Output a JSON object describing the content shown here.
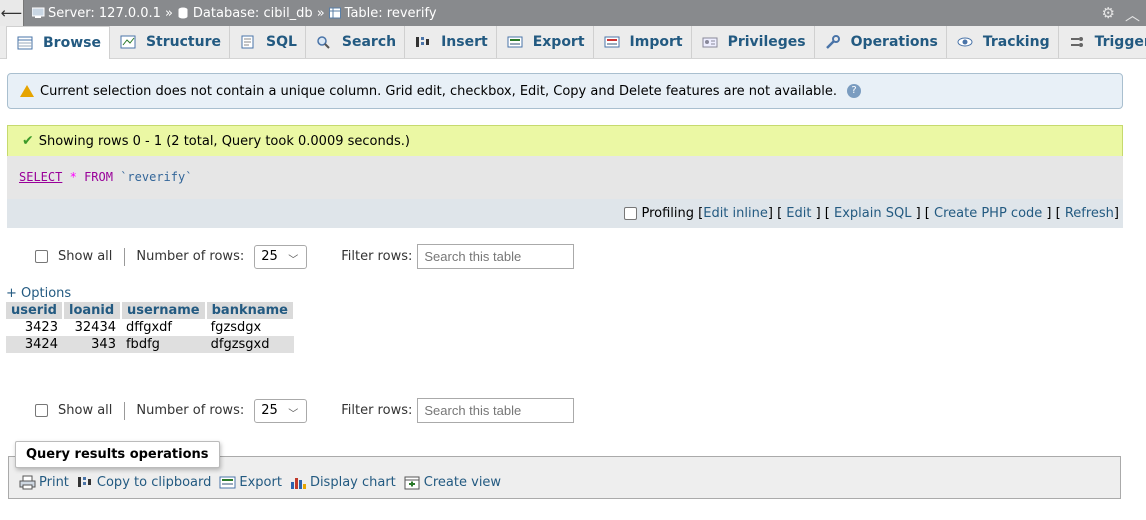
{
  "breadcrumb": {
    "server": "Server: 127.0.0.1",
    "database": "Database: cibil_db",
    "table": "Table: reverify",
    "separator": "»"
  },
  "tabs": [
    {
      "label": "Browse",
      "icon": "browse-icon"
    },
    {
      "label": "Structure",
      "icon": "structure-icon"
    },
    {
      "label": "SQL",
      "icon": "sql-icon"
    },
    {
      "label": "Search",
      "icon": "search-icon"
    },
    {
      "label": "Insert",
      "icon": "insert-icon"
    },
    {
      "label": "Export",
      "icon": "export-icon"
    },
    {
      "label": "Import",
      "icon": "import-icon"
    },
    {
      "label": "Privileges",
      "icon": "privileges-icon"
    },
    {
      "label": "Operations",
      "icon": "operations-icon"
    },
    {
      "label": "Tracking",
      "icon": "tracking-icon"
    },
    {
      "label": "Triggers",
      "icon": "triggers-icon"
    }
  ],
  "notice": {
    "text": "Current selection does not contain a unique column. Grid edit, checkbox, Edit, Copy and Delete features are not available."
  },
  "success": {
    "text": "Showing rows 0 - 1 (2 total, Query took 0.0009 seconds.)"
  },
  "query": {
    "select": "SELECT",
    "star": "*",
    "from": "FROM",
    "table": "`reverify`"
  },
  "sqlbar": {
    "profiling": "Profiling",
    "edit_inline": "Edit inline",
    "edit": "Edit",
    "explain_sql": "Explain SQL",
    "create_php": "Create PHP code",
    "refresh": "Refresh"
  },
  "nav": {
    "show_all": "Show all",
    "num_rows_label": "Number of rows:",
    "num_rows_value": "25",
    "filter_label": "Filter rows:",
    "filter_placeholder": "Search this table"
  },
  "options_label": "+ Options",
  "results": {
    "columns": [
      "userid",
      "loanid",
      "username",
      "bankname"
    ],
    "rows": [
      [
        "3423",
        "32434",
        "dffgxdf",
        "fgzsdgx"
      ],
      [
        "3424",
        "343",
        "fbdfg",
        "dfgzsgxd"
      ]
    ]
  },
  "query_ops": {
    "title": "Query results operations",
    "print": "Print",
    "copy": "Copy to clipboard",
    "export": "Export",
    "display_chart": "Display chart",
    "create_view": "Create view"
  }
}
